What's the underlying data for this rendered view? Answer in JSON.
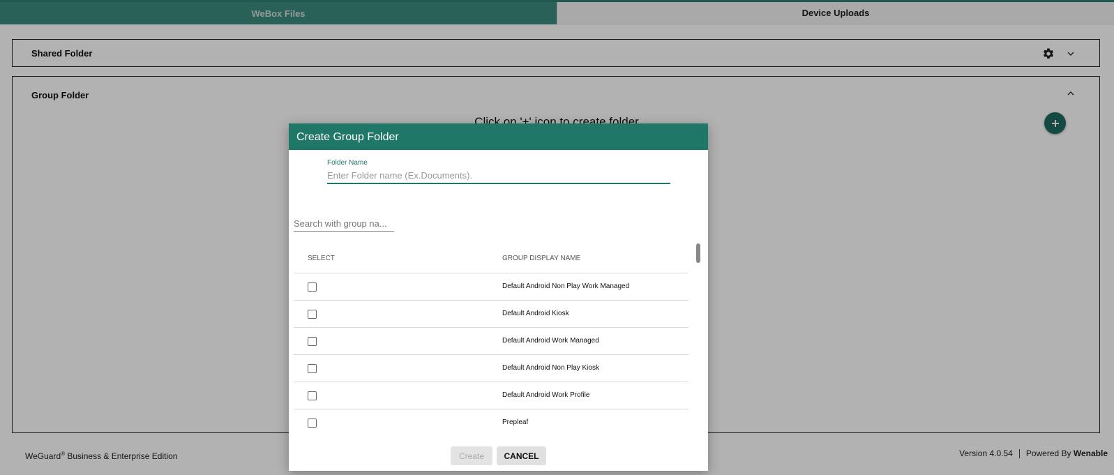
{
  "tabs": [
    {
      "label": "WeBox Files",
      "active": true
    },
    {
      "label": "Device Uploads",
      "active": false
    }
  ],
  "panels": {
    "shared": {
      "title": "Shared Folder"
    },
    "group": {
      "title": "Group Folder",
      "empty_message": "Click on '+' icon to create folder"
    }
  },
  "footer": {
    "product": "WeGuard",
    "reg_mark": "®",
    "edition": " Business & Enterprise Edition",
    "version": "Version 4.0.54",
    "powered_by": "Powered By",
    "brand": "Wenable"
  },
  "dialog": {
    "title": "Create Group Folder",
    "folder_name_label": "Folder Name",
    "folder_name_placeholder": "Enter Folder name (Ex.Documents).",
    "folder_name_value": "",
    "search_placeholder": "Search with group na...",
    "columns": [
      "SELECT",
      "GROUP DISPLAY NAME"
    ],
    "rows": [
      {
        "name": "Default Android Non Play Work Managed",
        "checked": false
      },
      {
        "name": "Default Android Kiosk",
        "checked": false
      },
      {
        "name": "Default Android Work Managed",
        "checked": false
      },
      {
        "name": "Default Android Non Play Kiosk",
        "checked": false
      },
      {
        "name": "Default Android Work Profile",
        "checked": false
      },
      {
        "name": "Prepleaf",
        "checked": false
      }
    ],
    "create_label": "Create",
    "cancel_label": "CANCEL"
  },
  "colors": {
    "accent": "#1f7767",
    "tab_active": "#3c8b80",
    "fab": "#1d6b5f"
  },
  "icons": {
    "settings": "gear-icon",
    "expand": "chevron-down-icon",
    "collapse": "chevron-up-icon",
    "add": "plus-icon"
  }
}
